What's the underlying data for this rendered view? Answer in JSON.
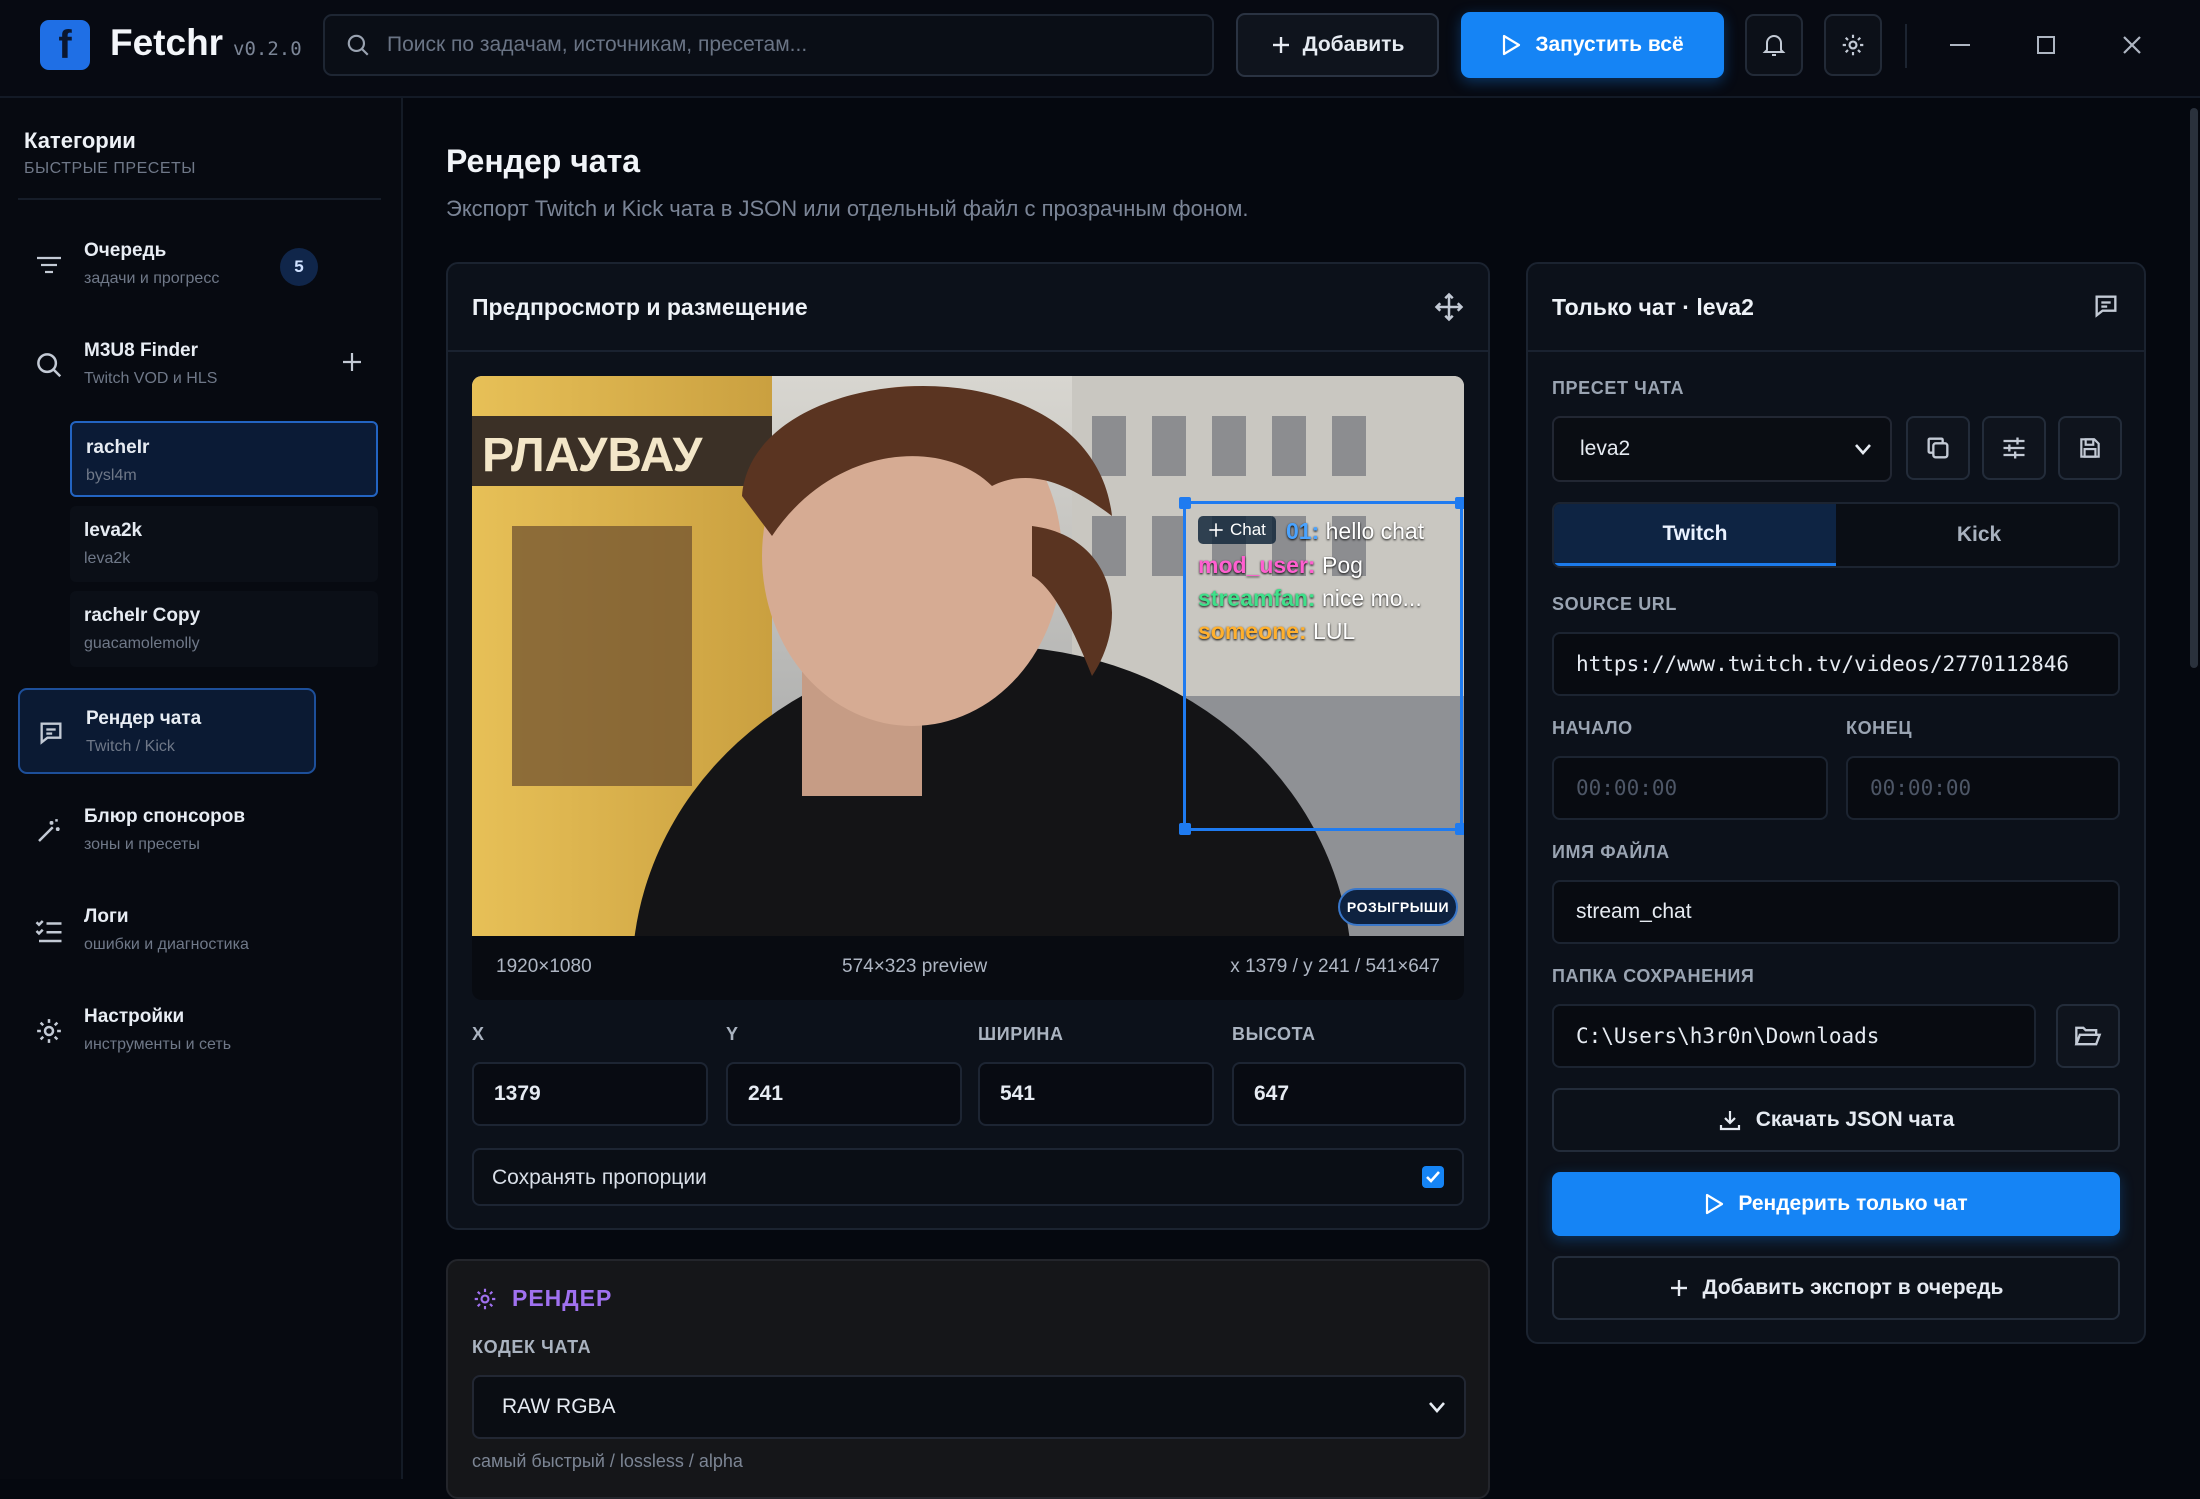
{
  "app": {
    "name": "Fetchr",
    "version": "v0.2.0"
  },
  "search": {
    "placeholder": "Поиск по задачам, источникам, пресетам..."
  },
  "toolbar": {
    "add_label": "Добавить",
    "run_all_label": "Запустить всё"
  },
  "sidebar": {
    "title": "Категории",
    "subtitle": "БЫСТРЫЕ ПРЕСЕТЫ",
    "queue": {
      "title": "Очередь",
      "subtitle": "задачи и прогресс",
      "badge": "5"
    },
    "m3u8": {
      "title": "M3U8 Finder",
      "subtitle": "Twitch VOD и HLS"
    },
    "presets": [
      {
        "title": "racheIr",
        "subtitle": "bysl4m"
      },
      {
        "title": "leva2k",
        "subtitle": "leva2k"
      },
      {
        "title": "racheIr Copy",
        "subtitle": "guacamolemolly"
      }
    ],
    "chat_render": {
      "title": "Рендер чата",
      "subtitle": "Twitch / Kick"
    },
    "sponsor_blur": {
      "title": "Блюр спонсоров",
      "subtitle": "зоны и пресеты"
    },
    "logs": {
      "title": "Логи",
      "subtitle": "ошибки и диагностика"
    },
    "settings": {
      "title": "Настройки",
      "subtitle": "инструменты и сеть"
    }
  },
  "page": {
    "title": "Рендер чата",
    "description": "Экспорт Twitch и Kick чата в JSON или отдельный файл с прозрачным фоном."
  },
  "preview_card": {
    "title": "Предпросмотр и размещение",
    "source_dims": "1920×1080",
    "preview_dims": "574×323 preview",
    "position_readout": "x 1379 / y 241 / 541×647",
    "chat_tag": "Chat",
    "sign_text": "РЛАУВАУ",
    "giveaway_label": "РОЗЫГРЫШИ",
    "chat_lines": [
      {
        "name": "01:",
        "text": " hello chat",
        "color": "#4aa3ff"
      },
      {
        "name": "mod_user:",
        "text": " Pog",
        "color": "#ff5fd0"
      },
      {
        "name": "streamfan:",
        "text": " nice mo...",
        "color": "#3fe08a"
      },
      {
        "name": "someone:",
        "text": " LUL",
        "color": "#ffb02e"
      }
    ],
    "fields": {
      "x_label": "X",
      "y_label": "Y",
      "w_label": "ШИРИНА",
      "h_label": "ВЫСОТА",
      "x": "1379",
      "y": "241",
      "w": "541",
      "h": "647"
    },
    "keep_ratio_label": "Сохранять пропорции",
    "keep_ratio": true
  },
  "render_card": {
    "title": "РЕНДЕР",
    "codec_label": "КОДЕК ЧАТА",
    "codec_value": "RAW RGBA",
    "codec_hint": "самый быстрый / lossless / alpha"
  },
  "right_panel": {
    "title": "Только чат · leva2",
    "preset_label": "ПРЕСЕТ ЧАТА",
    "preset_value": "leva2",
    "tabs": [
      "Twitch",
      "Kick"
    ],
    "source_label": "SOURCE URL",
    "source_value": "https://www.twitch.tv/videos/2770112846",
    "start_label": "НАЧАЛО",
    "end_label": "КОНЕЦ",
    "start_placeholder": "00:00:00",
    "end_placeholder": "00:00:00",
    "filename_label": "ИМЯ ФАЙЛА",
    "filename_value": "stream_chat",
    "folder_label": "ПАПКА СОХРАНЕНИЯ",
    "folder_value": "C:\\Users\\h3r0n\\Downloads",
    "download_json_label": "Скачать JSON чата",
    "render_only_label": "Рендерить только чат",
    "add_export_label": "Добавить экспорт в очередь"
  },
  "colors": {
    "accent": "#1584f5",
    "render_title": "#a071f0"
  }
}
